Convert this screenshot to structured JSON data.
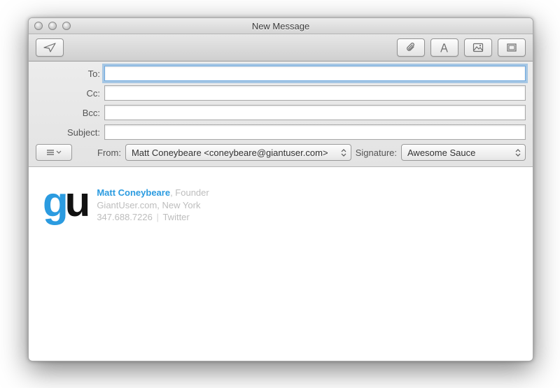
{
  "window": {
    "title": "New Message"
  },
  "fields": {
    "to_label": "To:",
    "cc_label": "Cc:",
    "bcc_label": "Bcc:",
    "subject_label": "Subject:",
    "to_value": "",
    "cc_value": "",
    "bcc_value": "",
    "subject_value": ""
  },
  "from": {
    "label": "From:",
    "value": "Matt Coneybeare <coneybeare@giantuser.com>"
  },
  "signature_select": {
    "label": "Signature:",
    "value": "Awesome Sauce"
  },
  "signature": {
    "logo_g": "g",
    "logo_u": "u",
    "name": "Matt Coneybeare",
    "role": "Founder",
    "company": "GiantUser.com",
    "location": "New York",
    "phone": "347.688.7226",
    "social": "Twitter",
    "sep_comma": ", ",
    "sep_pipe": " | "
  }
}
